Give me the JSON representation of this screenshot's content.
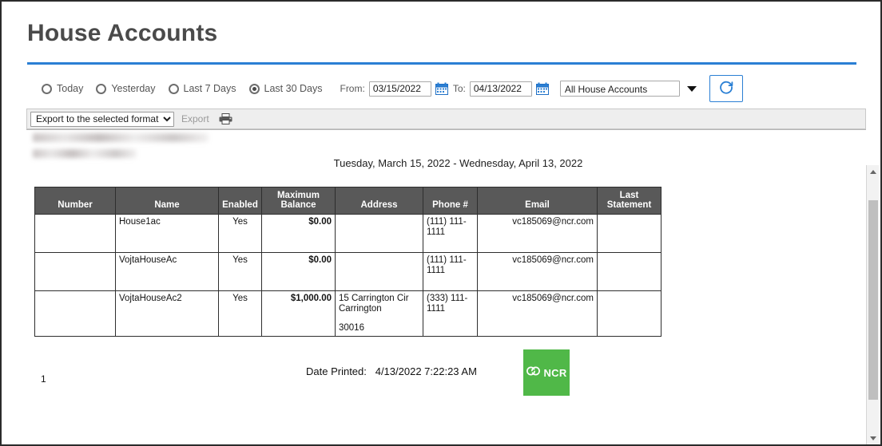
{
  "header": {
    "title": "House Accounts"
  },
  "filters": {
    "radios": [
      {
        "label": "Today",
        "selected": false
      },
      {
        "label": "Yesterday",
        "selected": false
      },
      {
        "label": "Last 7 Days",
        "selected": false
      },
      {
        "label": "Last 30 Days",
        "selected": true
      }
    ],
    "from_label": "From:",
    "from_value": "03/15/2022",
    "to_label": "To:",
    "to_value": "04/13/2022",
    "account_filter_value": "All House Accounts",
    "account_filter_options": [
      "All House Accounts"
    ],
    "refresh_icon": "refresh-icon",
    "calendar_icon": "calendar-icon"
  },
  "toolbar": {
    "export_format_value": "Export to the selected format",
    "export_format_options": [
      "Export to the selected format"
    ],
    "export_label": "Export",
    "print_icon": "printer-icon"
  },
  "report": {
    "date_range": "Tuesday, March 15, 2022 - Wednesday, April 13, 2022",
    "columns": [
      "Number",
      "Name",
      "Enabled",
      "Maximum Balance",
      "Address",
      "Phone #",
      "Email",
      "Last Statement"
    ],
    "rows": [
      {
        "number": "",
        "name": "House1ac",
        "enabled": "Yes",
        "maximum_balance": "$0.00",
        "address_line1": "",
        "address_line2": "",
        "address_zip": "",
        "phone": "(111) 111-1111",
        "email": "vc185069@ncr.com",
        "last_statement": ""
      },
      {
        "number": "",
        "name": "VojtaHouseAc",
        "enabled": "Yes",
        "maximum_balance": "$0.00",
        "address_line1": "",
        "address_line2": "",
        "address_zip": "",
        "phone": "(111) 111-1111",
        "email": "vc185069@ncr.com",
        "last_statement": ""
      },
      {
        "number": "",
        "name": "VojtaHouseAc2",
        "enabled": "Yes",
        "maximum_balance": "$1,000.00",
        "address_line1": "15 Carrington Cir",
        "address_line2": "Carrington",
        "address_zip": "30016",
        "phone": "(333) 111-1111",
        "email": "vc185069@ncr.com",
        "last_statement": ""
      }
    ],
    "footer": {
      "page_number": "1",
      "date_printed_label": "Date Printed:",
      "date_printed_value": "4/13/2022 7:22:23 AM",
      "logo_text": "NCR"
    }
  },
  "colors": {
    "accent_blue": "#2a7fd4",
    "table_header_bg": "#595959",
    "logo_green": "#50b848",
    "title_gray": "#4a4a4a"
  }
}
